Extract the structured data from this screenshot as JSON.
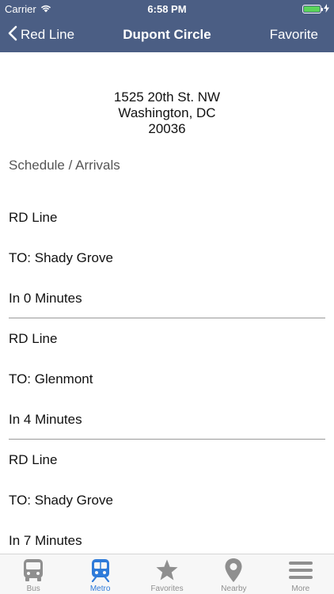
{
  "status_bar": {
    "carrier": "Carrier",
    "time": "6:58 PM",
    "battery_level": 1.0
  },
  "nav": {
    "back_label": "Red Line",
    "title": "Dupont Circle",
    "right_label": "Favorite"
  },
  "address": {
    "line1": "1525 20th St. NW",
    "line2": "Washington, DC",
    "line3": "20036"
  },
  "section_title": "Schedule / Arrivals",
  "arrivals": [
    {
      "line": "RD Line",
      "destination": "TO: Shady Grove",
      "eta": "In 0 Minutes"
    },
    {
      "line": "RD Line",
      "destination": "TO: Glenmont",
      "eta": "In 4 Minutes"
    },
    {
      "line": "RD Line",
      "destination": "TO: Shady Grove",
      "eta": "In 7 Minutes"
    }
  ],
  "tabs": [
    {
      "label": "Bus",
      "icon": "bus-icon",
      "active": false
    },
    {
      "label": "Metro",
      "icon": "train-icon",
      "active": true
    },
    {
      "label": "Favorites",
      "icon": "star-icon",
      "active": false
    },
    {
      "label": "Nearby",
      "icon": "location-pin-icon",
      "active": false
    },
    {
      "label": "More",
      "icon": "menu-icon",
      "active": false
    }
  ],
  "colors": {
    "nav_background": "#4b5e84",
    "tab_active": "#2f7bd9",
    "tab_inactive": "#8f8f8f",
    "battery": "#5ad45a"
  }
}
